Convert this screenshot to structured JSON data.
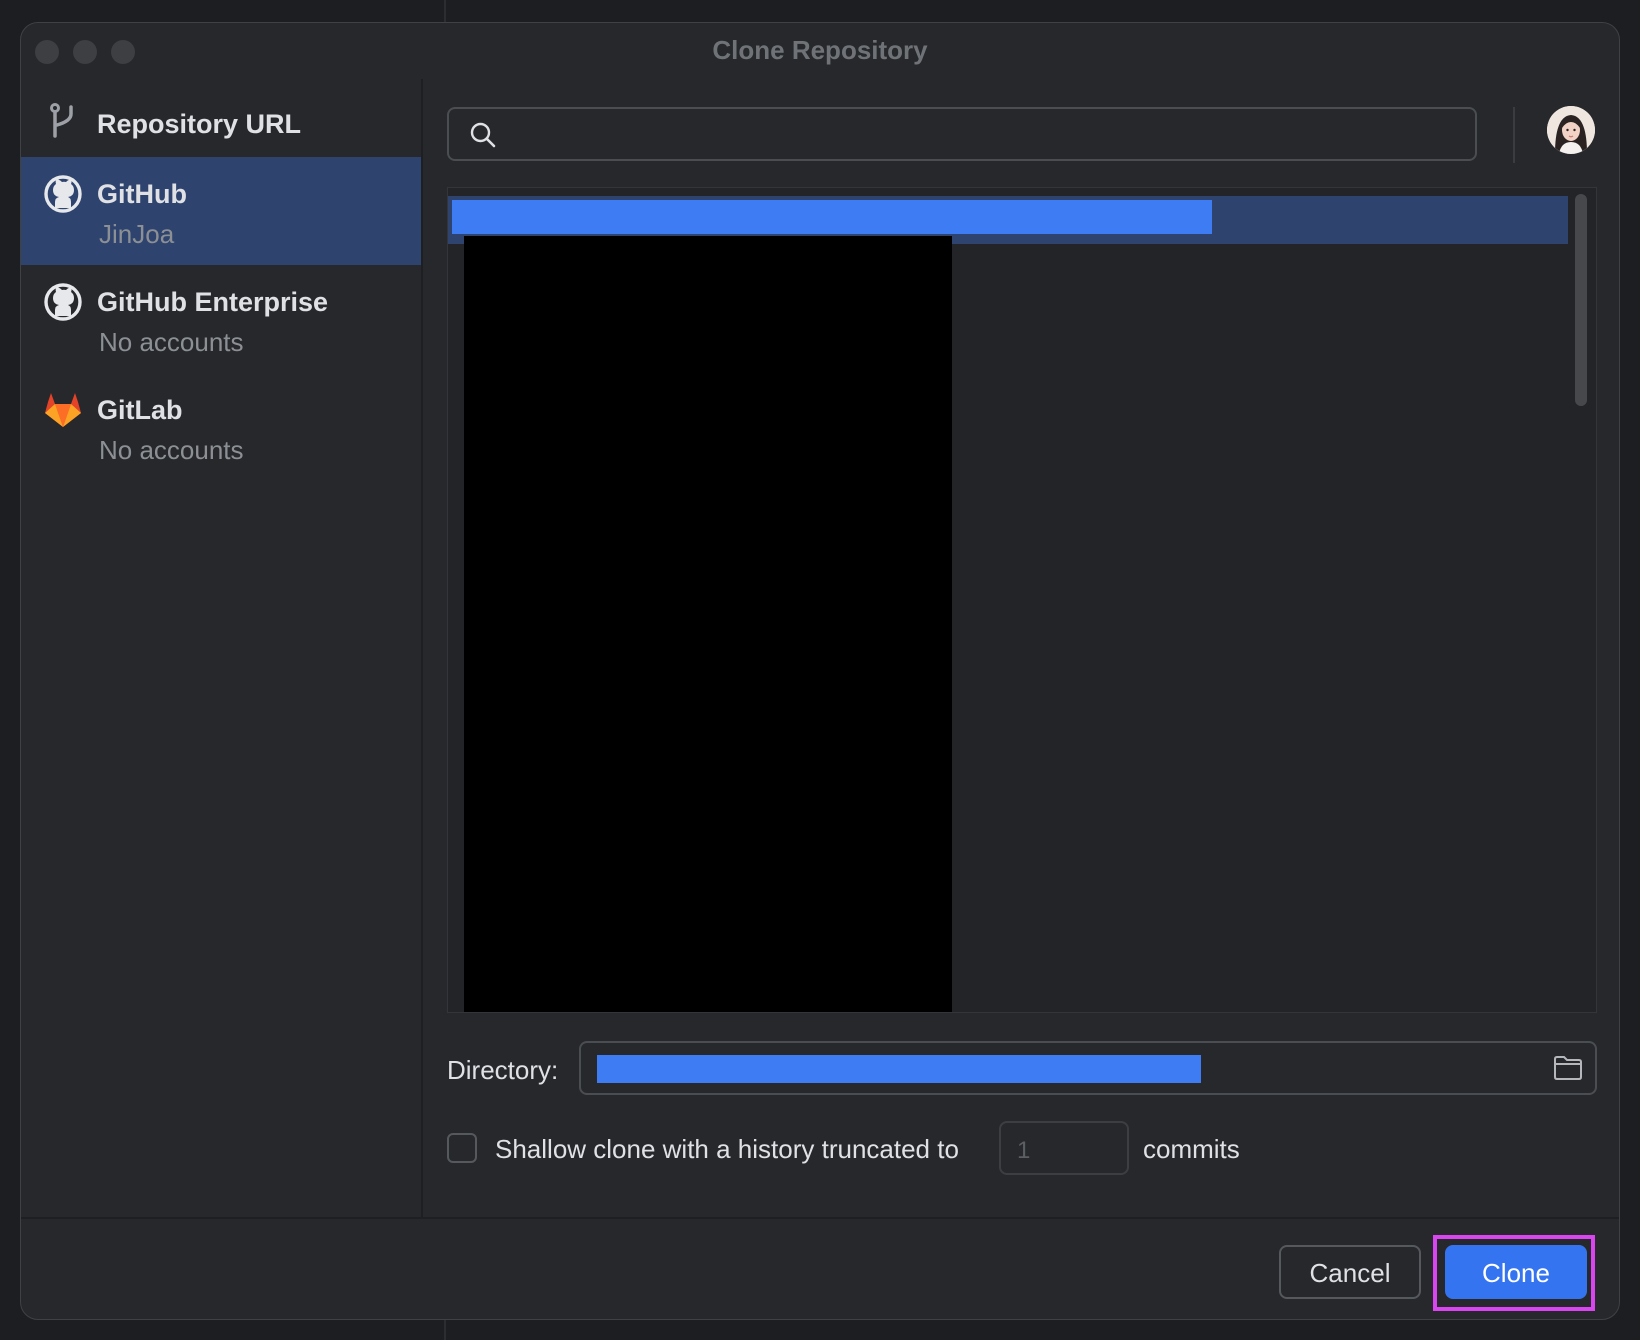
{
  "window": {
    "title": "Clone Repository"
  },
  "sidebar": {
    "items": [
      {
        "title": "Repository URL",
        "subtitle": "",
        "icon": "vcs-branch-icon",
        "selected": false
      },
      {
        "title": "GitHub",
        "subtitle": "JinJoa",
        "icon": "github-icon",
        "selected": true
      },
      {
        "title": "GitHub Enterprise",
        "subtitle": "No accounts",
        "icon": "github-icon",
        "selected": false
      },
      {
        "title": "GitLab",
        "subtitle": "No accounts",
        "icon": "gitlab-icon",
        "selected": false
      }
    ]
  },
  "search": {
    "placeholder": "",
    "value": ""
  },
  "account": {
    "icon": "avatar"
  },
  "directory": {
    "label": "Directory:",
    "icon": "folder-icon"
  },
  "shallow_clone": {
    "checked": false,
    "label": "Shallow clone with a history truncated to",
    "depth_placeholder": "1",
    "suffix": "commits"
  },
  "buttons": {
    "cancel": "Cancel",
    "clone": "Clone"
  },
  "colors": {
    "accent": "#3574f0",
    "selection": "#2e436e",
    "highlight": "#d946ef",
    "background": "#26282b"
  }
}
